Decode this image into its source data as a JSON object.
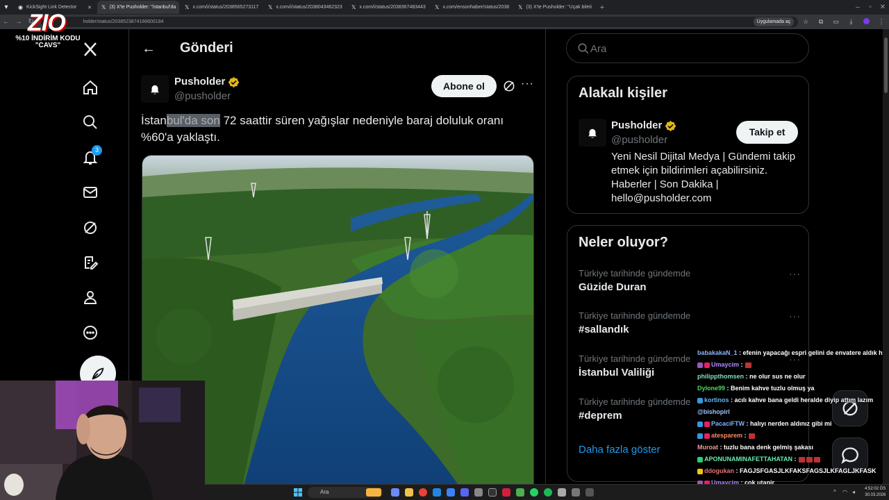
{
  "browser": {
    "tabs": [
      {
        "title": "KickSight Link Detector"
      },
      {
        "title": "(3) X'te Pusholder: \"İstanbul'da"
      },
      {
        "title": "x.com/i/status/2038565273117"
      },
      {
        "title": "x.com/i/status/2038043462323"
      },
      {
        "title": "x.com/i/status/2038367483443"
      },
      {
        "title": "x.com/ensonhaber/status/2038"
      },
      {
        "title": "(3) X'te Pusholder: \"Uçak bileti"
      }
    ],
    "url": "holder/status/2038523874166600184",
    "open_in_app": "Uygulamada aç"
  },
  "stream_overlay": {
    "logo_text": "ZIO",
    "promo_line1": "%10 İNDİRİM KODU",
    "promo_line2": "\"CAVS\""
  },
  "nav": {
    "notification_count": "3",
    "icons": [
      "x-logo-icon",
      "home-icon",
      "search-icon",
      "bell-icon",
      "mail-icon",
      "grok-icon",
      "premium-icon",
      "profile-icon",
      "more-icon",
      "compose-icon"
    ]
  },
  "post_header": {
    "title": "Gönderi"
  },
  "post": {
    "author_name": "Pusholder",
    "author_handle": "@pusholder",
    "subscribe_label": "Abone ol",
    "text_pre": "İstan",
    "text_highlight": "bul'da son",
    "text_post": " 72 saattir süren yağışlar nedeniyle baraj doluluk oranı %60'a yaklaştı.",
    "image_alt": "Aerial view of reservoir with aqueduct bridge"
  },
  "search": {
    "placeholder": "Ara"
  },
  "related": {
    "title": "Alakalı kişiler",
    "name": "Pusholder",
    "handle": "@pusholder",
    "follow_label": "Takip et",
    "bio": "Yeni Nesil Dijital Medya | Gündemi takip etmek için bildirimleri açabilirsiniz. Haberler | Son Dakika | hello@pusholder.com"
  },
  "trends": {
    "title": "Neler oluyor?",
    "items": [
      {
        "context": "Türkiye tarihinde gündemde",
        "name": "Güzide Duran"
      },
      {
        "context": "Türkiye tarihinde gündemde",
        "name": "#sallandık"
      },
      {
        "context": "Türkiye tarihinde gündemde",
        "name": "İstanbul Valiliği"
      },
      {
        "context": "Türkiye tarihinde gündemde",
        "name": "#deprem"
      }
    ],
    "show_more": "Daha fazla göster"
  },
  "chat": [
    {
      "user": "babakakaN_1",
      "color": "#8ab4f8",
      "text": "efenin yapacağı espri gelini de envatere aldık he"
    },
    {
      "user": "Umaycim",
      "color": "#b388ff",
      "text": ""
    },
    {
      "user": "philippthomsen",
      "color": "#7ee0c3",
      "text": "ne olur sus ne olur"
    },
    {
      "user": "Dylone99",
      "color": "#4cd964",
      "text": "Benim kahve tuzlu olmuş ya"
    },
    {
      "user": "kortinos",
      "color": "#64b5f6",
      "text": "acılı kahve bana geldi heralde diyip attım lazım"
    },
    {
      "user": "",
      "color": "#a0c4ff",
      "text": "@bishopirl"
    },
    {
      "user": "PacaciFTW",
      "color": "#82b1ff",
      "text": "halıyı nerden aldınız gibi mi"
    },
    {
      "user": "atesparem",
      "color": "#ff8a65",
      "text": ""
    },
    {
      "user": "Muroat",
      "color": "#ef9a9a",
      "text": "tuzlu bana denk gelmiş şakası"
    },
    {
      "user": "APONUNAMINAFETTAHATAN",
      "color": "#69f0ae",
      "text": ""
    },
    {
      "user": "ddogukan",
      "color": "#e57373",
      "text": "FAGJSFGASJLKFAKSFAGSJLKFAGLJKFASK"
    },
    {
      "user": "Umaycim",
      "color": "#b388ff",
      "text": "çok utanir"
    }
  ],
  "taskbar": {
    "search_placeholder": "Ara",
    "time": "4:52:02 ÖS",
    "date": "30.03.2026"
  },
  "colors": {
    "accent": "#1d9bf0",
    "background": "#000000",
    "border": "#2f3336",
    "muted_text": "#71767b"
  }
}
